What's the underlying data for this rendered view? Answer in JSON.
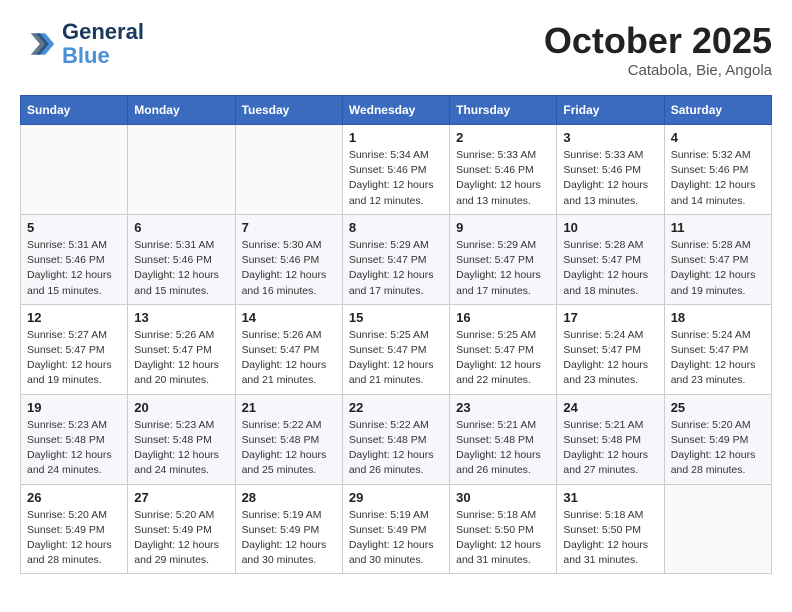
{
  "header": {
    "logo_line1": "General",
    "logo_line2": "Blue",
    "month": "October 2025",
    "location": "Catabola, Bie, Angola"
  },
  "days_of_week": [
    "Sunday",
    "Monday",
    "Tuesday",
    "Wednesday",
    "Thursday",
    "Friday",
    "Saturday"
  ],
  "weeks": [
    [
      {
        "day": "",
        "info": ""
      },
      {
        "day": "",
        "info": ""
      },
      {
        "day": "",
        "info": ""
      },
      {
        "day": "1",
        "info": "Sunrise: 5:34 AM\nSunset: 5:46 PM\nDaylight: 12 hours and 12 minutes."
      },
      {
        "day": "2",
        "info": "Sunrise: 5:33 AM\nSunset: 5:46 PM\nDaylight: 12 hours and 13 minutes."
      },
      {
        "day": "3",
        "info": "Sunrise: 5:33 AM\nSunset: 5:46 PM\nDaylight: 12 hours and 13 minutes."
      },
      {
        "day": "4",
        "info": "Sunrise: 5:32 AM\nSunset: 5:46 PM\nDaylight: 12 hours and 14 minutes."
      }
    ],
    [
      {
        "day": "5",
        "info": "Sunrise: 5:31 AM\nSunset: 5:46 PM\nDaylight: 12 hours and 15 minutes."
      },
      {
        "day": "6",
        "info": "Sunrise: 5:31 AM\nSunset: 5:46 PM\nDaylight: 12 hours and 15 minutes."
      },
      {
        "day": "7",
        "info": "Sunrise: 5:30 AM\nSunset: 5:46 PM\nDaylight: 12 hours and 16 minutes."
      },
      {
        "day": "8",
        "info": "Sunrise: 5:29 AM\nSunset: 5:47 PM\nDaylight: 12 hours and 17 minutes."
      },
      {
        "day": "9",
        "info": "Sunrise: 5:29 AM\nSunset: 5:47 PM\nDaylight: 12 hours and 17 minutes."
      },
      {
        "day": "10",
        "info": "Sunrise: 5:28 AM\nSunset: 5:47 PM\nDaylight: 12 hours and 18 minutes."
      },
      {
        "day": "11",
        "info": "Sunrise: 5:28 AM\nSunset: 5:47 PM\nDaylight: 12 hours and 19 minutes."
      }
    ],
    [
      {
        "day": "12",
        "info": "Sunrise: 5:27 AM\nSunset: 5:47 PM\nDaylight: 12 hours and 19 minutes."
      },
      {
        "day": "13",
        "info": "Sunrise: 5:26 AM\nSunset: 5:47 PM\nDaylight: 12 hours and 20 minutes."
      },
      {
        "day": "14",
        "info": "Sunrise: 5:26 AM\nSunset: 5:47 PM\nDaylight: 12 hours and 21 minutes."
      },
      {
        "day": "15",
        "info": "Sunrise: 5:25 AM\nSunset: 5:47 PM\nDaylight: 12 hours and 21 minutes."
      },
      {
        "day": "16",
        "info": "Sunrise: 5:25 AM\nSunset: 5:47 PM\nDaylight: 12 hours and 22 minutes."
      },
      {
        "day": "17",
        "info": "Sunrise: 5:24 AM\nSunset: 5:47 PM\nDaylight: 12 hours and 23 minutes."
      },
      {
        "day": "18",
        "info": "Sunrise: 5:24 AM\nSunset: 5:47 PM\nDaylight: 12 hours and 23 minutes."
      }
    ],
    [
      {
        "day": "19",
        "info": "Sunrise: 5:23 AM\nSunset: 5:48 PM\nDaylight: 12 hours and 24 minutes."
      },
      {
        "day": "20",
        "info": "Sunrise: 5:23 AM\nSunset: 5:48 PM\nDaylight: 12 hours and 24 minutes."
      },
      {
        "day": "21",
        "info": "Sunrise: 5:22 AM\nSunset: 5:48 PM\nDaylight: 12 hours and 25 minutes."
      },
      {
        "day": "22",
        "info": "Sunrise: 5:22 AM\nSunset: 5:48 PM\nDaylight: 12 hours and 26 minutes."
      },
      {
        "day": "23",
        "info": "Sunrise: 5:21 AM\nSunset: 5:48 PM\nDaylight: 12 hours and 26 minutes."
      },
      {
        "day": "24",
        "info": "Sunrise: 5:21 AM\nSunset: 5:48 PM\nDaylight: 12 hours and 27 minutes."
      },
      {
        "day": "25",
        "info": "Sunrise: 5:20 AM\nSunset: 5:49 PM\nDaylight: 12 hours and 28 minutes."
      }
    ],
    [
      {
        "day": "26",
        "info": "Sunrise: 5:20 AM\nSunset: 5:49 PM\nDaylight: 12 hours and 28 minutes."
      },
      {
        "day": "27",
        "info": "Sunrise: 5:20 AM\nSunset: 5:49 PM\nDaylight: 12 hours and 29 minutes."
      },
      {
        "day": "28",
        "info": "Sunrise: 5:19 AM\nSunset: 5:49 PM\nDaylight: 12 hours and 30 minutes."
      },
      {
        "day": "29",
        "info": "Sunrise: 5:19 AM\nSunset: 5:49 PM\nDaylight: 12 hours and 30 minutes."
      },
      {
        "day": "30",
        "info": "Sunrise: 5:18 AM\nSunset: 5:50 PM\nDaylight: 12 hours and 31 minutes."
      },
      {
        "day": "31",
        "info": "Sunrise: 5:18 AM\nSunset: 5:50 PM\nDaylight: 12 hours and 31 minutes."
      },
      {
        "day": "",
        "info": ""
      }
    ]
  ]
}
